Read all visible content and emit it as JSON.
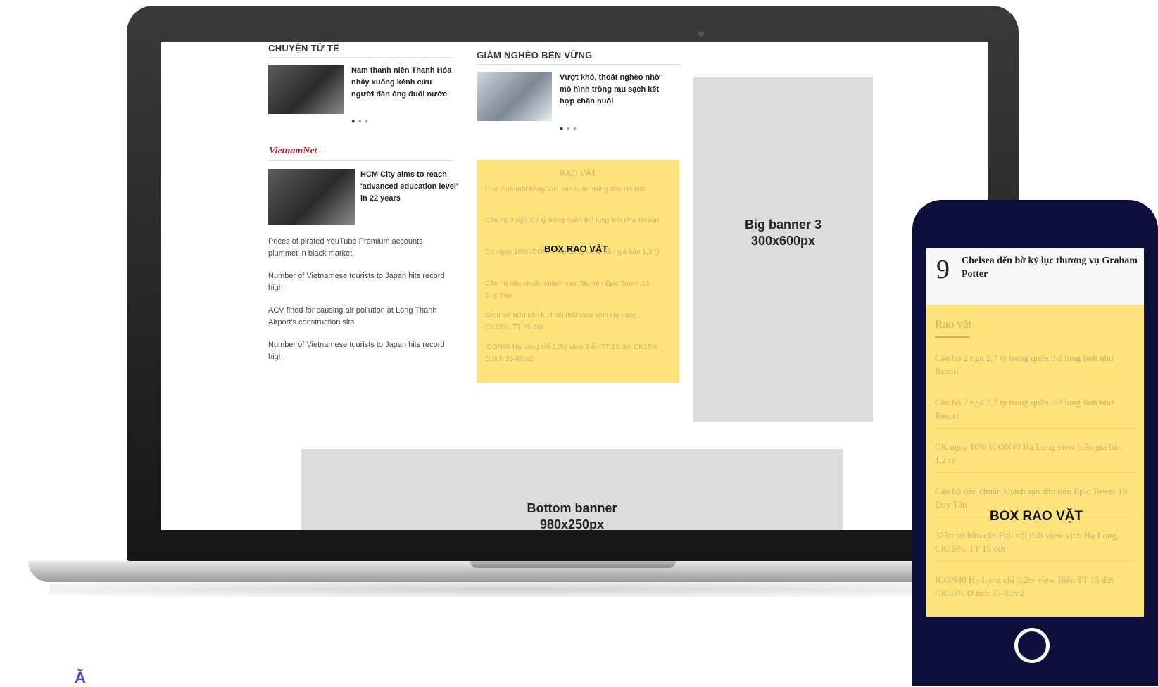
{
  "laptop": {
    "left_column": {
      "section_title": "CHUYỆN TỬ TẾ",
      "feature_headline": "Nam thanh niên Thanh Hóa nhảy xuống kênh cứu người đàn ông đuối nước",
      "vietnamnet_logo": "VietnamNet",
      "english_feature_headline": "HCM City aims to reach 'advanced education level' in 22 years",
      "english_items": [
        "Prices of pirated YouTube Premium accounts plummet in black market",
        "Number of Vietnamese tourists to Japan hits record high",
        "ACV fined for causing air pollution at Long Thanh Airport's construction site",
        "Number of Vietnamese tourists to Japan hits record high"
      ]
    },
    "middle_column": {
      "section_title": "GIẢM NGHÈO BỀN VỮNG",
      "feature_headline": "Vượt khó, thoát nghèo nhờ mô hình trồng rau sạch kết hợp chăn nuôi",
      "rao_vat": {
        "title": "RAO VẶT",
        "label": "BOX RAO VẶT",
        "items": [
          "Cho thuê mặt bằng VIP, các quận trung tâm Hà Nội",
          "Căn hộ 2 ngủ 2,7 tỷ trong quần thể lung linh như Resort",
          "CK ngay 10% ICON40 Hạ Long view biển giá bán 1,2 tỷ",
          "Căn hộ tiêu chuẩn khách sạn đầu tiên Epic Tower 19 Duy Tân",
          "325tr sở hữu căn Full nội thất view vịnh Hạ Long, CK15%, TT 15 đợt",
          "ICON40 Hạ Long chỉ 1,2tỷ view Biển TT 15 đợt CK15% D.tích 35-80m2"
        ]
      }
    },
    "big_banner": {
      "line1": "Big banner 3",
      "line2": "300x600px"
    },
    "bottom_banner": {
      "line1": "Bottom banner",
      "line2": "980x250px"
    }
  },
  "phone": {
    "rank": "9",
    "headline": "Chelsea đến bờ kỷ lục thương vụ Graham Potter",
    "rao_title": "Rao vặt",
    "label": "BOX RAO VẶT",
    "items": [
      "Căn hộ 2 ngủ 2,7 tỷ trong quần thể lung linh như Resort",
      "Căn hộ 2 ngủ 2,7 tỷ trong quần thể lung linh như Resort",
      "CK ngay 10% ICON40 Hạ Long view biển giá bán 1,2 tỷ",
      "Căn hộ tiêu chuẩn khách sạn đầu tiên Epic Tower 19 Duy Tân",
      "325tr sở hữu căn Full nội thất view vịnh Hạ Long, CK15%, TT 15 đợt",
      "ICON40 Hạ Long chỉ 1,2tỷ view Biển TT 15 đợt CK15% D.tích 35-80m2"
    ]
  },
  "corner_mark": "Ă",
  "colors": {
    "rao_vat_bg": "#fde37a",
    "banner_bg": "#dcdcdc",
    "phone_frame": "#0d0f3a"
  }
}
